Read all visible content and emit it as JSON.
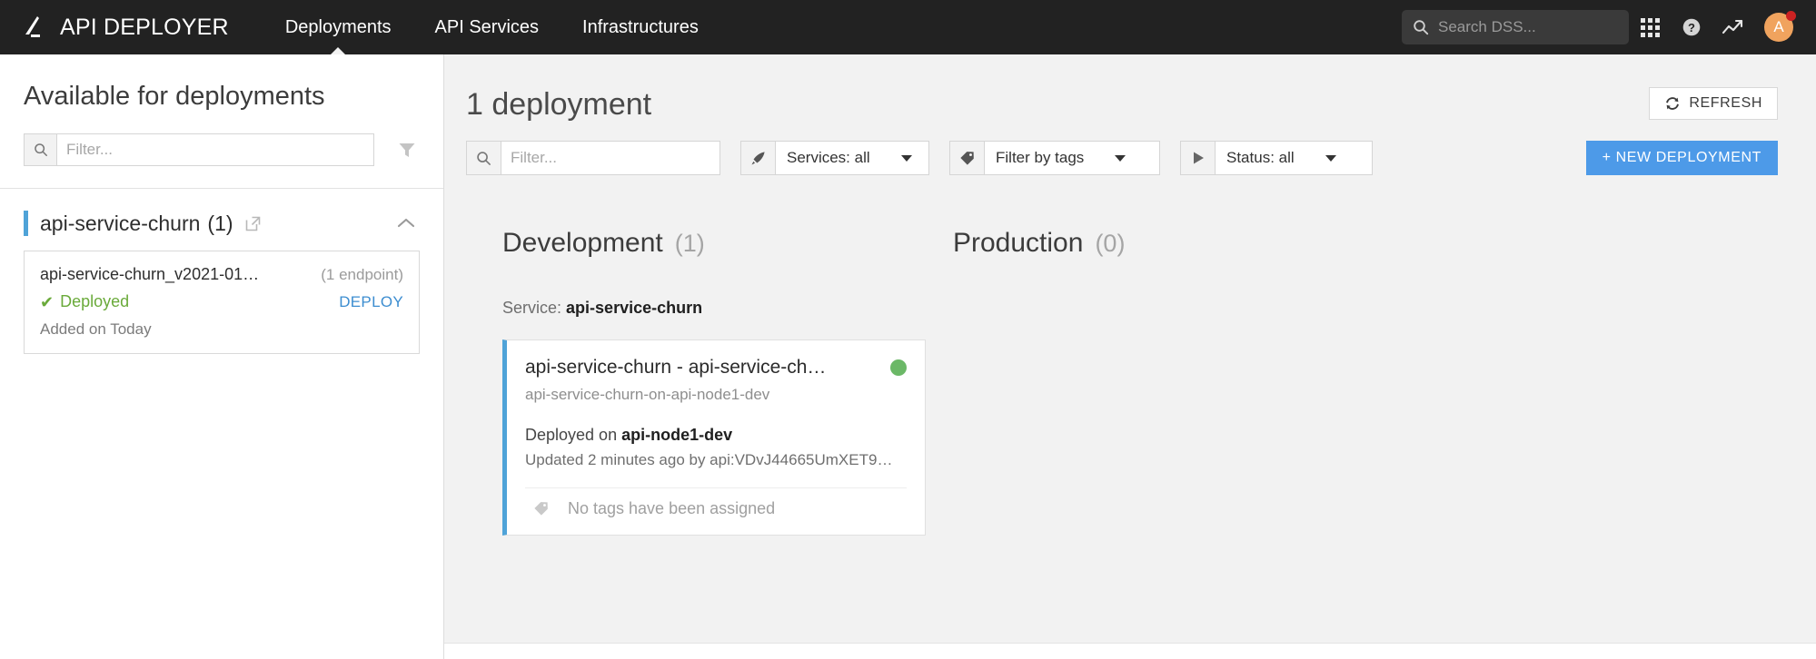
{
  "topnav": {
    "logo_icon": "dataiku-logo-icon",
    "brand": "API DEPLOYER",
    "links": [
      {
        "label": "Deployments",
        "active": true
      },
      {
        "label": "API Services",
        "active": false
      },
      {
        "label": "Infrastructures",
        "active": false
      }
    ],
    "search": {
      "placeholder": "Search DSS...",
      "value": "",
      "icon": "search-icon"
    },
    "icons": [
      {
        "name": "apps-grid-icon"
      },
      {
        "name": "help-question-icon"
      },
      {
        "name": "activity-trend-icon"
      }
    ],
    "avatar": {
      "initial": "A",
      "color": "#f0a35e",
      "badge": true
    }
  },
  "sidebar": {
    "title": "Available for deployments",
    "filter": {
      "placeholder": "Filter...",
      "value": "",
      "icon": "search-icon"
    },
    "funnel_icon": "funnel-filter-icon",
    "service_group": {
      "name": "api-service-churn",
      "count": "(1)",
      "external_link_icon": "external-link-icon",
      "collapse_icon": "chevron-up-icon",
      "accent_color": "#4fa3d8",
      "versions": [
        {
          "name": "api-service-churn_v2021-01…",
          "endpoints": "(1 endpoint)",
          "status": "Deployed",
          "status_icon": "check-icon",
          "status_color": "#6aaa3a",
          "deploy_label": "DEPLOY",
          "added": "Added on Today"
        }
      ]
    }
  },
  "main": {
    "title": "1 deployment",
    "refresh": {
      "label": "REFRESH",
      "icon": "refresh-icon"
    },
    "toolbar": {
      "filter": {
        "placeholder": "Filter...",
        "value": "",
        "icon": "search-icon"
      },
      "services": {
        "label": "Services: all",
        "icon": "rocket-icon",
        "caret": "caret-down-icon"
      },
      "tags": {
        "label": "Filter by tags",
        "icon": "tag-icon",
        "caret": "caret-down-icon"
      },
      "status": {
        "label": "Status: all",
        "icon": "play-triangle-icon",
        "caret": "caret-down-icon"
      },
      "new_deployment": {
        "label": "+ NEW DEPLOYMENT",
        "color": "#4d9ae8"
      }
    },
    "columns": [
      {
        "name": "Development",
        "count": "(1)",
        "service_label": "Service:",
        "service_name": "api-service-churn",
        "cards": [
          {
            "title": "api-service-churn - api-service-ch…",
            "subtitle": "api-service-churn-on-api-node1-dev",
            "deployed_prefix": "Deployed on",
            "deployed_node": "api-node1-dev",
            "updated": "Updated 2 minutes ago by api:VDvJ44665UmXET9…",
            "tags_icon": "tag-icon",
            "tags_text": "No tags have been assigned",
            "status_color": "#6bb867",
            "accent_color": "#4fa3d8"
          }
        ]
      },
      {
        "name": "Production",
        "count": "(0)",
        "cards": []
      }
    ]
  }
}
